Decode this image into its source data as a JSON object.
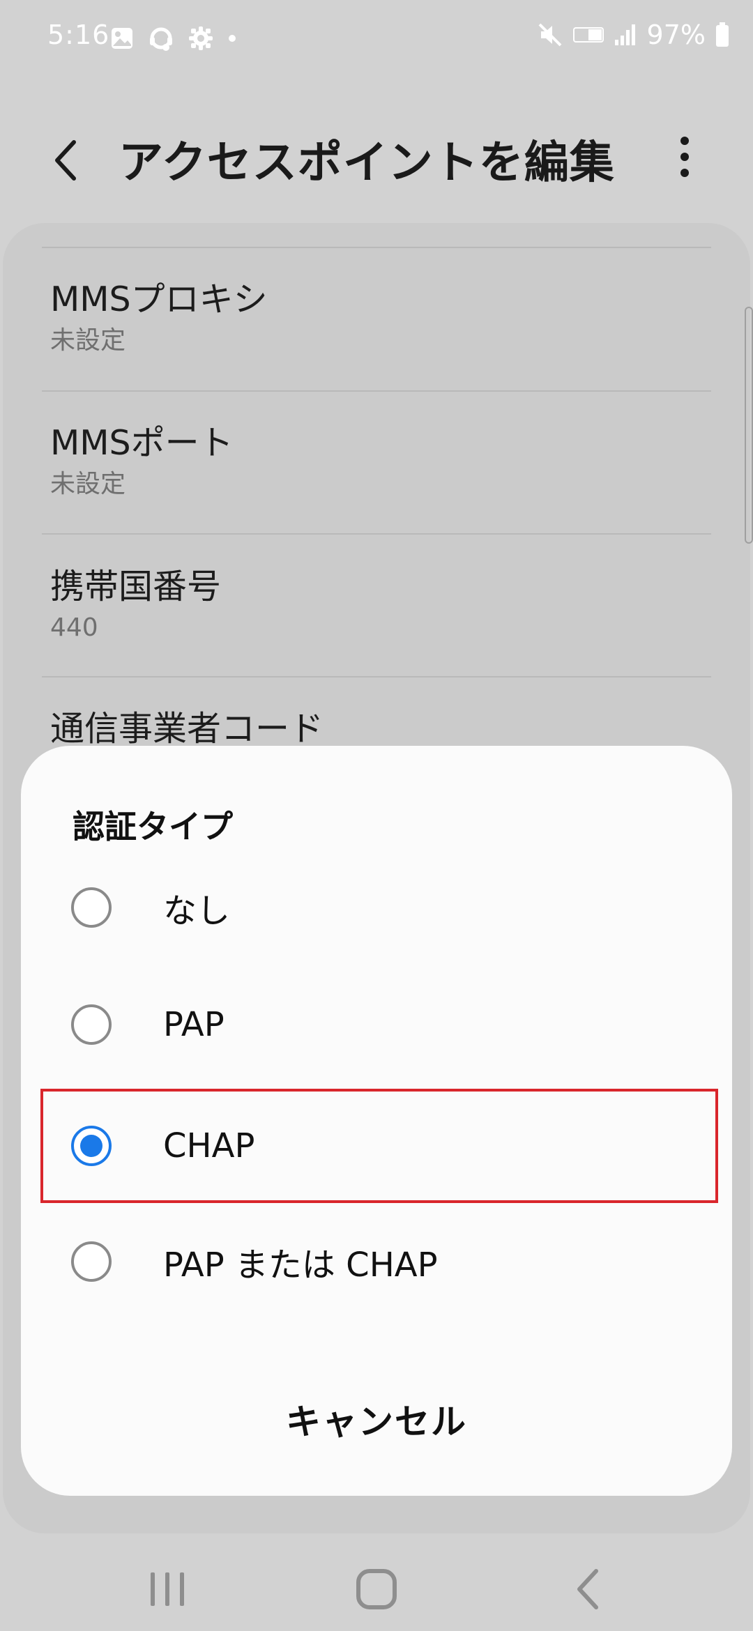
{
  "status_bar": {
    "time": "5:16",
    "battery": "97%"
  },
  "app_bar": {
    "title": "アクセスポイントを編集"
  },
  "settings": {
    "items": [
      {
        "title": "MMSプロキシ",
        "summary": "未設定"
      },
      {
        "title": "MMSポート",
        "summary": "未設定"
      },
      {
        "title": "携帯国番号",
        "summary": "440"
      },
      {
        "title": "通信事業者コード",
        "summary": ""
      }
    ]
  },
  "dialog": {
    "title": "認証タイプ",
    "options": [
      {
        "label": "なし",
        "selected": false
      },
      {
        "label": "PAP",
        "selected": false
      },
      {
        "label": "CHAP",
        "selected": true
      },
      {
        "label": "PAP または CHAP",
        "selected": false
      }
    ],
    "cancel_label": "キャンセル"
  },
  "colors": {
    "accent": "#1a79e8",
    "highlight": "#d9262c",
    "dim_background": "#d2d2d2"
  },
  "icons": {
    "status_left": [
      "gallery-icon",
      "headset-sync-icon",
      "settings-gear-icon",
      "dot-icon"
    ],
    "status_right": [
      "mute-icon",
      "volte-icon",
      "signal-icon",
      "battery-icon"
    ],
    "nav": [
      "recent-apps-icon",
      "home-icon",
      "back-icon"
    ]
  }
}
